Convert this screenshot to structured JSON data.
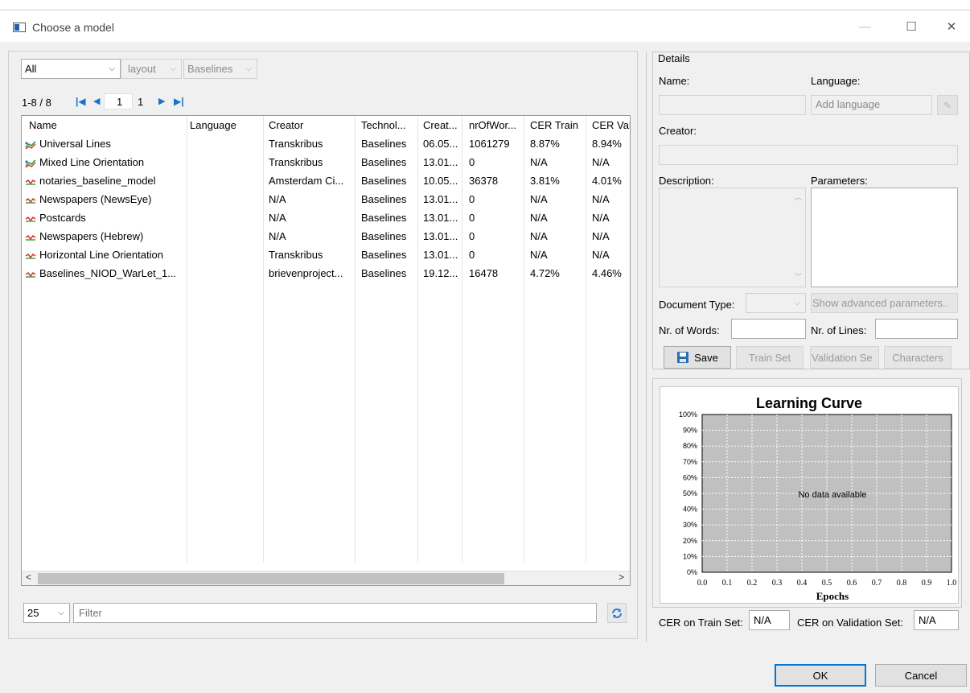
{
  "window": {
    "title": "Choose a model",
    "minimize": "—",
    "maximize": "☐",
    "close": "✕"
  },
  "filters": {
    "type_value": "All",
    "layout_value": "layout",
    "baselines_value": "Baselines"
  },
  "paging": {
    "range": "1-8 / 8",
    "page": "1",
    "total_pages": "1"
  },
  "table": {
    "columns": [
      "Name",
      "Language",
      "Creator",
      "Technol...",
      "Creat...",
      "nrOfWor...",
      "CER Train",
      "CER Vali"
    ],
    "rows": [
      {
        "icon": "multicolor-lines-icon",
        "name": "Universal Lines",
        "language": "",
        "creator": "Transkribus",
        "tech": "Baselines",
        "created": "06.05...",
        "words": "1061279",
        "cer_train": "8.87%",
        "cer_val": "8.94%"
      },
      {
        "icon": "multicolor-lines-icon",
        "name": "Mixed Line Orientation",
        "language": "",
        "creator": "Transkribus",
        "tech": "Baselines",
        "created": "13.01...",
        "words": "0",
        "cer_train": "N/A",
        "cer_val": "N/A"
      },
      {
        "icon": "red-lines-icon",
        "name": "notaries_baseline_model",
        "language": "",
        "creator": "Amsterdam Ci...",
        "tech": "Baselines",
        "created": "10.05...",
        "words": "36378",
        "cer_train": "3.81%",
        "cer_val": "4.01%"
      },
      {
        "icon": "red-lines-icon",
        "name": "Newspapers (NewsEye)",
        "language": "",
        "creator": "N/A",
        "tech": "Baselines",
        "created": "13.01...",
        "words": "0",
        "cer_train": "N/A",
        "cer_val": "N/A"
      },
      {
        "icon": "red-lines-icon",
        "name": "Postcards",
        "language": "",
        "creator": "N/A",
        "tech": "Baselines",
        "created": "13.01...",
        "words": "0",
        "cer_train": "N/A",
        "cer_val": "N/A"
      },
      {
        "icon": "red-lines-icon",
        "name": "Newspapers (Hebrew)",
        "language": "",
        "creator": "N/A",
        "tech": "Baselines",
        "created": "13.01...",
        "words": "0",
        "cer_train": "N/A",
        "cer_val": "N/A"
      },
      {
        "icon": "red-lines-icon",
        "name": "Horizontal Line Orientation",
        "language": "",
        "creator": "Transkribus",
        "tech": "Baselines",
        "created": "13.01...",
        "words": "0",
        "cer_train": "N/A",
        "cer_val": "N/A"
      },
      {
        "icon": "red-lines-icon",
        "name": "Baselines_NIOD_WarLet_1...",
        "language": "",
        "creator": "brievenproject...",
        "tech": "Baselines",
        "created": "19.12...",
        "words": "16478",
        "cer_train": "4.72%",
        "cer_val": "4.46%"
      }
    ]
  },
  "bottom": {
    "page_size": "25",
    "filter_placeholder": "Filter"
  },
  "details": {
    "legend": "Details",
    "name_label": "Name:",
    "language_label": "Language:",
    "language_placeholder": "Add language",
    "creator_label": "Creator:",
    "description_label": "Description:",
    "parameters_label": "Parameters:",
    "doc_type_label": "Document Type:",
    "show_advanced": "Show advanced parameters..",
    "nr_words_label": "Nr. of Words:",
    "nr_lines_label": "Nr. of Lines:",
    "save": "Save",
    "train_set": "Train Set",
    "validation_set": "Validation Se",
    "characters": "Characters"
  },
  "chart_data": {
    "type": "line",
    "title": "Learning Curve",
    "xlabel": "Epochs",
    "ylabel": "",
    "xlim": [
      0.0,
      1.0
    ],
    "ylim": [
      0,
      100
    ],
    "x_ticks": [
      "0.0",
      "0.1",
      "0.2",
      "0.3",
      "0.4",
      "0.5",
      "0.6",
      "0.7",
      "0.8",
      "0.9",
      "1.0"
    ],
    "y_ticks": [
      "0%",
      "10%",
      "20%",
      "30%",
      "40%",
      "50%",
      "60%",
      "70%",
      "80%",
      "90%",
      "100%"
    ],
    "series": [],
    "annotation": "No data available",
    "grid": true,
    "plot_background": "#c0c0c0"
  },
  "cer": {
    "train_label": "CER on Train Set:",
    "train_value": "N/A",
    "validation_label": "CER on Validation Set:",
    "validation_value": "N/A"
  },
  "footer": {
    "ok": "OK",
    "cancel": "Cancel"
  },
  "colors": {
    "accent": "#0078d7",
    "nav_blue": "#1a73c9"
  }
}
